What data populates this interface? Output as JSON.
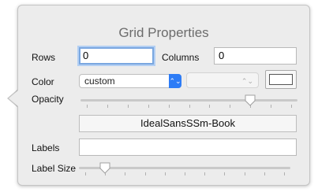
{
  "title": "Grid Properties",
  "rows": {
    "label": "Rows",
    "value": "0"
  },
  "columns": {
    "label": "Columns",
    "value": "0"
  },
  "color": {
    "label": "Color",
    "selected": "custom",
    "swatch": "#ffffff"
  },
  "opacity": {
    "label": "Opacity",
    "level": 0.8
  },
  "font": {
    "name": "IdealSansSSm-Book"
  },
  "labels": {
    "label": "Labels",
    "value": ""
  },
  "label_size": {
    "label": "Label Size",
    "level": 0.1
  },
  "icons": {
    "popup_arrows": "⌃⌄",
    "stepper_arrows": "⌃⌄"
  },
  "colors": {
    "accent": "#2d7cf6",
    "focus_ring": "#7aa7e0"
  }
}
